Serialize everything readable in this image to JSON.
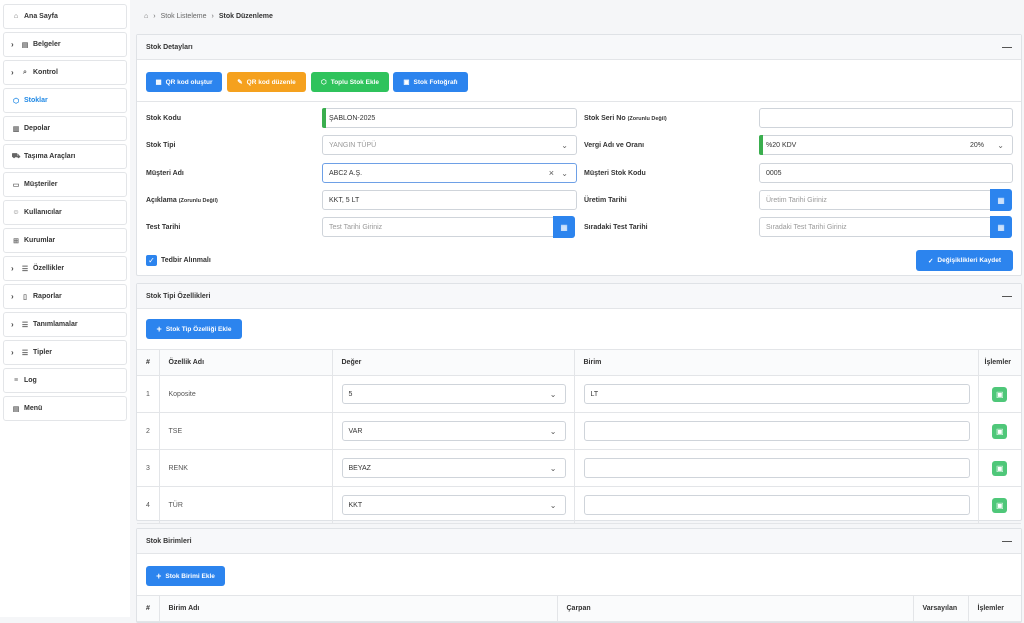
{
  "sidebar": {
    "items": [
      {
        "label": "Ana Sayfa",
        "icon": "home-icon"
      },
      {
        "label": "Belgeler",
        "icon": "document-icon"
      },
      {
        "label": "Kontrol",
        "icon": "search-icon"
      },
      {
        "label": "Stoklar",
        "icon": "box-icon"
      },
      {
        "label": "Depolar",
        "icon": "warehouse-icon"
      },
      {
        "label": "Taşıma Araçları",
        "icon": "car-icon"
      },
      {
        "label": "Müşteriler",
        "icon": "folder-icon"
      },
      {
        "label": "Kullanıcılar",
        "icon": "users-icon"
      },
      {
        "label": "Kurumlar",
        "icon": "org-icon"
      },
      {
        "label": "Özellikler",
        "icon": "list-icon"
      },
      {
        "label": "Raporlar",
        "icon": "file-icon"
      },
      {
        "label": "Tanımlamalar",
        "icon": "list-icon"
      },
      {
        "label": "Tipler",
        "icon": "list-icon"
      },
      {
        "label": "Log",
        "icon": "menu-icon"
      },
      {
        "label": "Menü",
        "icon": "menu-icon"
      }
    ]
  },
  "breadcrumb": {
    "items": [
      "Stok Listeleme",
      "Stok Düzenleme"
    ]
  },
  "details": {
    "title": "Stok Detayları",
    "buttons": {
      "qr_create": "QR kod oluştur",
      "qr_edit": "QR kod düzenle",
      "bulk_add": "Toplu Stok Ekle",
      "photo": "Stok Fotoğrafı"
    },
    "fields": {
      "stock_code": {
        "label": "Stok Kodu",
        "value": "ŞABLON-2025"
      },
      "serial_no": {
        "label": "Stok Seri No",
        "note": "(Zorunlu Değil)",
        "value": ""
      },
      "stock_type": {
        "label": "Stok Tipi",
        "value": "YANGIN TÜPÜ"
      },
      "tax": {
        "label": "Vergi Adı ve Oranı",
        "value": "%20 KDV",
        "rate": "20%"
      },
      "customer": {
        "label": "Müşteri Adı",
        "value": "ABC2 A.Ş."
      },
      "customer_stock_code": {
        "label": "Müşteri Stok Kodu",
        "value": "0005"
      },
      "description": {
        "label": "Açıklama",
        "note": "(Zorunlu Değil)",
        "value": "KKT, 5 LT"
      },
      "production_date": {
        "label": "Üretim Tarihi",
        "placeholder": "Üretim Tarihi Giriniz"
      },
      "test_date": {
        "label": "Test Tarihi",
        "placeholder": "Test Tarihi Giriniz"
      },
      "next_test_date": {
        "label": "Sıradaki Test Tarihi",
        "placeholder": "Sıradaki Test Tarihi Giriniz"
      }
    },
    "checkbox_label": "Tedbir Alınmalı",
    "save_label": "Değişiklikleri Kaydet"
  },
  "type_props": {
    "title": "Stok Tipi Özellikleri",
    "add_label": "Stok Tip Özelliği Ekle",
    "headers": [
      "#",
      "Özellik Adı",
      "Değer",
      "Birim",
      "İşlemler"
    ],
    "rows": [
      {
        "no": "1",
        "name": "Koposite",
        "value": "5",
        "unit": "LT"
      },
      {
        "no": "2",
        "name": "TSE",
        "value": "VAR",
        "unit": ""
      },
      {
        "no": "3",
        "name": "RENK",
        "value": "BEYAZ",
        "unit": ""
      },
      {
        "no": "4",
        "name": "TÜR",
        "value": "KKT",
        "unit": ""
      }
    ]
  },
  "units": {
    "title": "Stok Birimleri",
    "add_label": "Stok Birimi Ekle",
    "headers": [
      "#",
      "Birim Adı",
      "Çarpan",
      "Varsayılan",
      "İşlemler"
    ]
  },
  "colors": {
    "primary": "#2c84ee",
    "orange": "#f5a11e",
    "green": "#2fc35c",
    "save": "#4fc779"
  }
}
